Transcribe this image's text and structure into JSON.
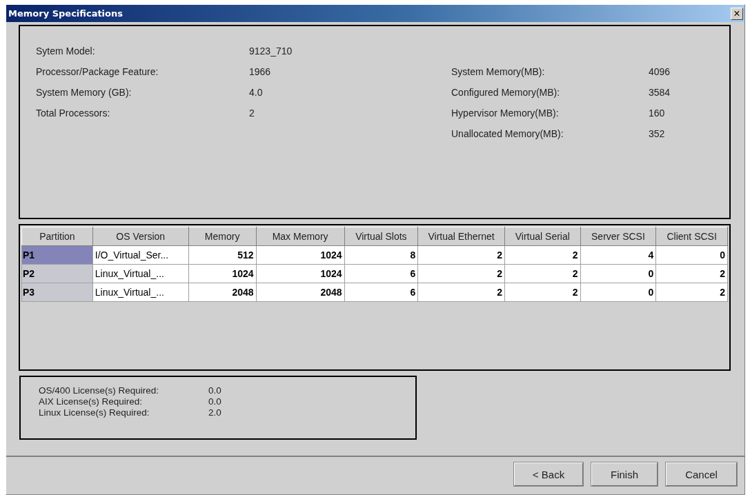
{
  "window": {
    "title": "Memory Specifications",
    "close": "×"
  },
  "system_info": {
    "left": [
      {
        "label": "Sytem Model:",
        "value": "9123_710"
      },
      {
        "label": "Processor/Package Feature:",
        "value": "1966"
      },
      {
        "label": "System Memory (GB):",
        "value": "4.0"
      },
      {
        "label": "Total Processors:",
        "value": "2"
      }
    ],
    "right": [
      {
        "label": "System Memory(MB):",
        "value": "4096"
      },
      {
        "label": "Configured Memory(MB):",
        "value": "3584"
      },
      {
        "label": "Hypervisor Memory(MB):",
        "value": "160"
      },
      {
        "label": "Unallocated Memory(MB):",
        "value": "352"
      }
    ]
  },
  "table": {
    "columns": [
      "Partition",
      "OS Version",
      "Memory",
      "Max Memory",
      "Virtual Slots",
      "Virtual Ethernet",
      "Virtual Serial",
      "Server SCSI",
      "Client SCSI"
    ],
    "rows": [
      {
        "selected": true,
        "cells": [
          "P1",
          "I/O_Virtual_Ser...",
          "512",
          "1024",
          "8",
          "2",
          "2",
          "4",
          "0"
        ]
      },
      {
        "selected": false,
        "cells": [
          "P2",
          "Linux_Virtual_...",
          "1024",
          "1024",
          "6",
          "2",
          "2",
          "0",
          "2"
        ]
      },
      {
        "selected": false,
        "cells": [
          "P3",
          "Linux_Virtual_...",
          "2048",
          "2048",
          "6",
          "2",
          "2",
          "0",
          "2"
        ]
      }
    ]
  },
  "licenses": [
    {
      "label": "OS/400 License(s) Required:",
      "value": "0.0"
    },
    {
      "label": "AIX License(s) Required:",
      "value": "0.0"
    },
    {
      "label": "Linux License(s) Required:",
      "value": "2.0"
    }
  ],
  "buttons": [
    "< Back",
    "Finish",
    "Cancel"
  ]
}
